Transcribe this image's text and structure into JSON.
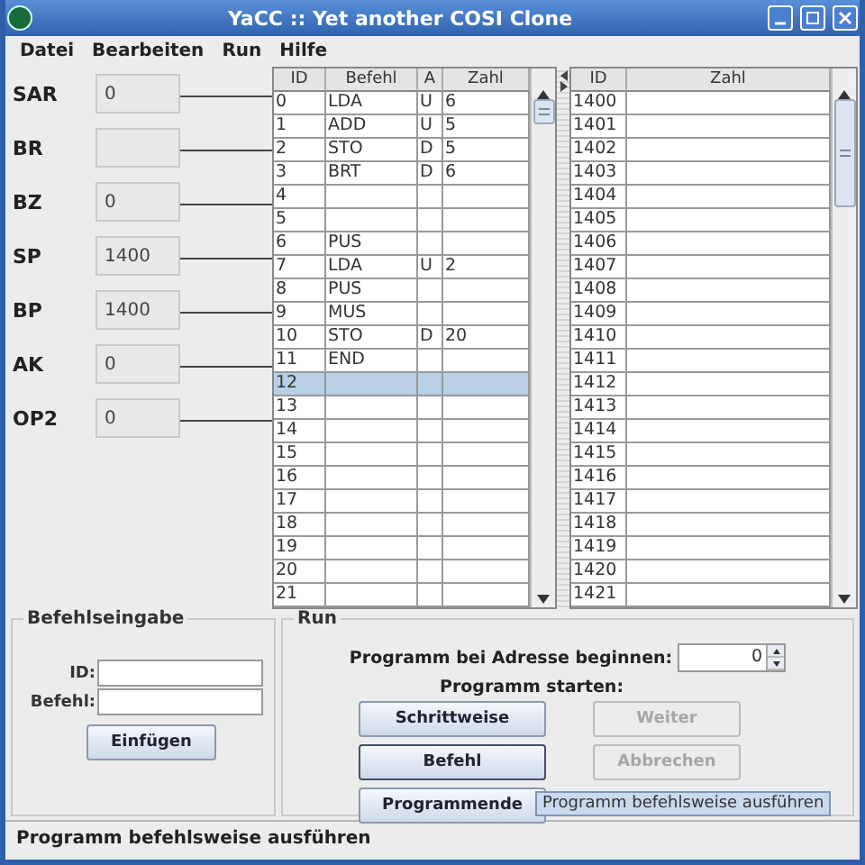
{
  "window": {
    "title": "YaCC :: Yet another COSI Clone"
  },
  "menu": [
    "Datei",
    "Bearbeiten",
    "Run",
    "Hilfe"
  ],
  "registers": [
    {
      "label": "SAR",
      "value": "0"
    },
    {
      "label": "BR"
    },
    {
      "label": "BZ",
      "value": "0"
    },
    {
      "label": "SP",
      "value": "1400"
    },
    {
      "label": "BP",
      "value": "1400"
    },
    {
      "label": "AK",
      "value": "0"
    },
    {
      "label": "OP2",
      "value": "0"
    }
  ],
  "program_table": {
    "columns": [
      "ID",
      "Befehl",
      "A",
      "Zahl"
    ],
    "rows": [
      {
        "address": "0",
        "befehl": "LDA",
        "a": "U",
        "zahl": "6",
        "selected": false
      },
      {
        "address": "1",
        "befehl": "ADD",
        "a": "U",
        "zahl": "5",
        "selected": false
      },
      {
        "address": "2",
        "befehl": "STO",
        "a": "D",
        "zahl": "5",
        "selected": false
      },
      {
        "address": "3",
        "befehl": "BRT",
        "a": "D",
        "zahl": "6",
        "selected": false
      },
      {
        "address": "4",
        "selected": false
      },
      {
        "address": "5",
        "selected": false
      },
      {
        "address": "6",
        "befehl": "PUS",
        "selected": false
      },
      {
        "address": "7",
        "befehl": "LDA",
        "a": "U",
        "zahl": "2",
        "selected": false
      },
      {
        "address": "8",
        "befehl": "PUS",
        "selected": false
      },
      {
        "address": "9",
        "befehl": "MUS",
        "selected": false
      },
      {
        "address": "10",
        "befehl": "STO",
        "a": "D",
        "zahl": "20",
        "selected": false
      },
      {
        "address": "11",
        "befehl": "END",
        "selected": false
      },
      {
        "address": "12",
        "selected": true
      },
      {
        "address": "13",
        "selected": false
      },
      {
        "address": "14",
        "selected": false
      },
      {
        "address": "15",
        "selected": false
      },
      {
        "address": "16",
        "selected": false
      },
      {
        "address": "17",
        "selected": false
      },
      {
        "address": "18",
        "selected": false
      },
      {
        "address": "19",
        "selected": false
      },
      {
        "address": "20",
        "selected": false
      },
      {
        "address": "21",
        "selected": false
      }
    ]
  },
  "memory_table": {
    "columns": [
      "ID",
      "Zahl"
    ],
    "rows": [
      {
        "address": "1400"
      },
      {
        "address": "1401"
      },
      {
        "address": "1402"
      },
      {
        "address": "1403"
      },
      {
        "address": "1404"
      },
      {
        "address": "1405"
      },
      {
        "address": "1406"
      },
      {
        "address": "1407"
      },
      {
        "address": "1408"
      },
      {
        "address": "1409"
      },
      {
        "address": "1410"
      },
      {
        "address": "1411"
      },
      {
        "address": "1412"
      },
      {
        "address": "1413"
      },
      {
        "address": "1414"
      },
      {
        "address": "1415"
      },
      {
        "address": "1416"
      },
      {
        "address": "1417"
      },
      {
        "address": "1418"
      },
      {
        "address": "1419"
      },
      {
        "address": "1420"
      },
      {
        "address": "1421"
      }
    ]
  },
  "command_input": {
    "title": "Befehlseingabe",
    "fields": [
      {
        "label": "ID:"
      },
      {
        "label": "Befehl:"
      }
    ],
    "button": "Einfügen"
  },
  "run": {
    "title": "Run",
    "start_address_label": "Programm bei Adresse beginnen:",
    "start_address": "0",
    "start_label": "Programm starten:",
    "buttons": [
      {
        "label": "Schrittweise",
        "disabled": false,
        "focused": false
      },
      {
        "label": "Weiter",
        "disabled": true,
        "focused": false
      },
      {
        "label": "Befehl",
        "disabled": false,
        "focused": true
      },
      {
        "label": "Abbrechen",
        "disabled": true,
        "focused": false
      },
      {
        "label": "Programmende",
        "disabled": false,
        "focused": false
      }
    ]
  },
  "tooltip": "Programm befehlsweise ausführen",
  "status_bar": "Programm befehlsweise ausführen"
}
